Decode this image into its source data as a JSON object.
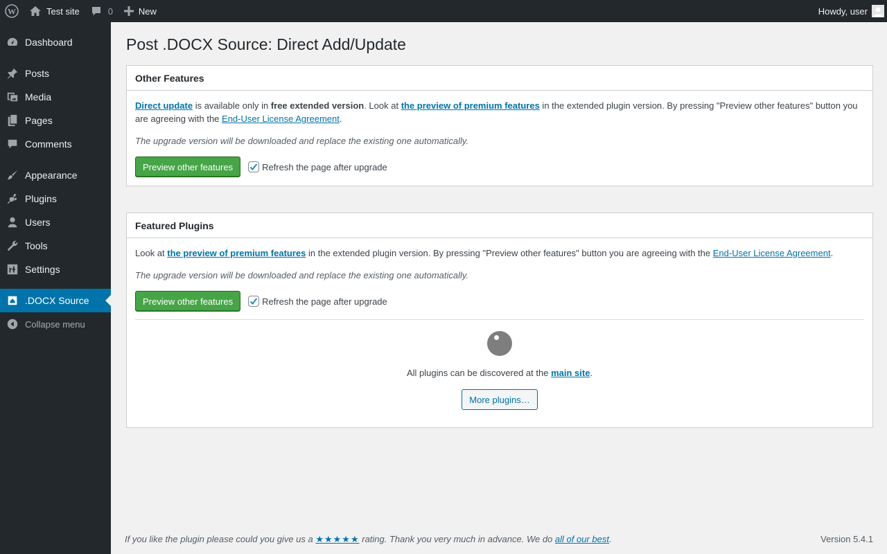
{
  "adminbar": {
    "site_name": "Test site",
    "comments_count": "0",
    "new_label": "New",
    "greeting": "Howdy, user"
  },
  "sidebar": {
    "items": [
      {
        "label": "Dashboard",
        "icon": "dashboard-icon"
      },
      {
        "label": "Posts",
        "icon": "pin-icon"
      },
      {
        "label": "Media",
        "icon": "media-icon"
      },
      {
        "label": "Pages",
        "icon": "pages-icon"
      },
      {
        "label": "Comments",
        "icon": "comment-icon"
      },
      {
        "label": "Appearance",
        "icon": "brush-icon"
      },
      {
        "label": "Plugins",
        "icon": "plug-icon"
      },
      {
        "label": "Users",
        "icon": "user-icon"
      },
      {
        "label": "Tools",
        "icon": "wrench-icon"
      },
      {
        "label": "Settings",
        "icon": "settings-icon"
      },
      {
        "label": ".DOCX Source",
        "icon": "docx-icon",
        "current": true
      }
    ],
    "collapse_label": "Collapse menu"
  },
  "page": {
    "title": "Post .DOCX Source: Direct Add/Update"
  },
  "other_features": {
    "heading": "Other Features",
    "link_direct_update": "Direct update",
    "text_available": " is available only in ",
    "bold_free": "free extended version",
    "text_look": ". Look at ",
    "link_preview": "the preview of premium features",
    "text_rest": " in the extended plugin version. By pressing \"Preview other features\" button you are agreeing with the ",
    "link_eula": "End-User License Agreement",
    "period": ".",
    "note": "The upgrade version will be downloaded and replace the existing one automatically.",
    "button_label": "Preview other features",
    "checkbox_label": "Refresh the page after upgrade",
    "checkbox_checked": true
  },
  "featured_plugins": {
    "heading": "Featured Plugins",
    "text_look": "Look at ",
    "link_preview": "the preview of premium features",
    "text_rest": " in the extended plugin version. By pressing \"Preview other features\" button you are agreeing with the ",
    "link_eula": "End-User License Agreement",
    "period": ".",
    "note": "The upgrade version will be downloaded and replace the existing one automatically.",
    "button_label": "Preview other features",
    "checkbox_label": "Refresh the page after upgrade",
    "checkbox_checked": true,
    "discover_text": "All plugins can be discovered at the ",
    "link_main_site": "main site",
    "more_button": "More plugins…"
  },
  "footer": {
    "text_before": "If you like the plugin please could you give us a ",
    "stars": "★★★★★",
    "text_middle": " rating. Thank you very much in advance. We do ",
    "link_best": "all of our best",
    "text_end": ".",
    "version": "Version 5.4.1"
  },
  "colors": {
    "adminbar_bg": "#23282d",
    "accent": "#0073aa",
    "button_green": "#46a546"
  }
}
